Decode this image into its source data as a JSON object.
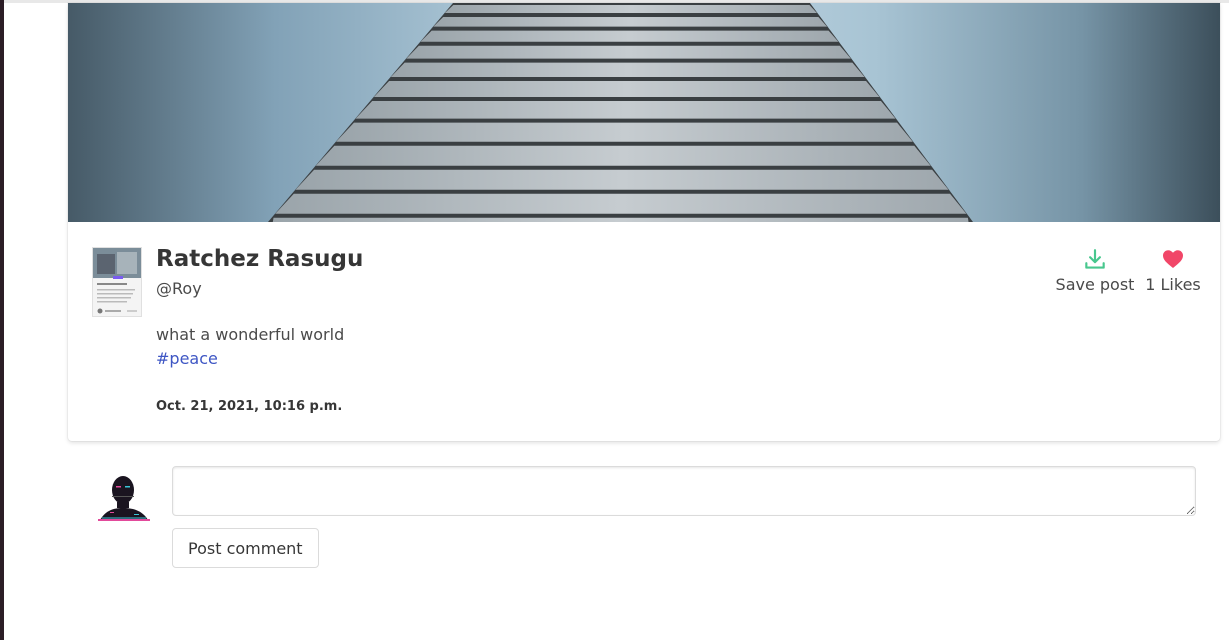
{
  "post": {
    "author_name": "Ratchez Rasugu",
    "handle": "@Roy",
    "caption": "what a wonderful world",
    "hashtag": "#peace",
    "timestamp": "Oct. 21, 2021, 10:16 p.m.",
    "actions": {
      "save_label": "Save post",
      "save_icon": "download-icon",
      "likes_label": "1 Likes",
      "likes_icon": "heart-icon"
    }
  },
  "comment": {
    "input_value": "",
    "input_placeholder": "",
    "submit_label": "Post comment"
  },
  "colors": {
    "accent_link": "#3e56c4",
    "save_icon": "#48c78e",
    "heart_icon": "#f14668"
  }
}
